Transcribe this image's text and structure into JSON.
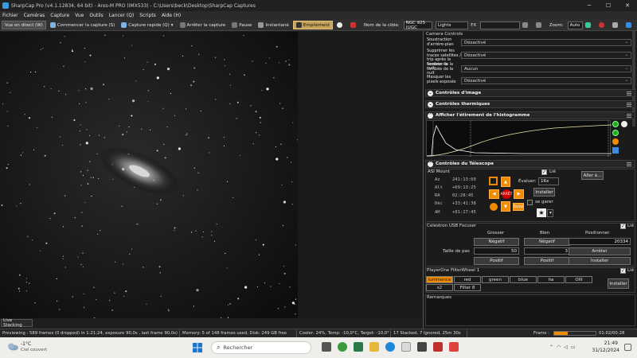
{
  "window": {
    "title": "SharpCap Pro (v4.1.12834, 64 bit) - Ares-M PRO (IMX533) - C:\\Users\\beck\\Desktop\\SharpCap Captures",
    "minimize": "─",
    "maximize": "☐",
    "close": "✕"
  },
  "menu": [
    "Fichier",
    "Caméras",
    "Capture",
    "Vue",
    "Outils",
    "Lancer (Q)",
    "Scripts",
    "Aide (H)"
  ],
  "toolbar": {
    "live_view": "Vue en direct (W)",
    "start_capture": "Commencer la capture (S)",
    "quick_capture": "Capture rapide (Q)",
    "stop_capture": "Arrêter la capture",
    "pause": "Pause",
    "snapshot": "Instantané",
    "stacking": "Empilement",
    "target_label": "Nom de la cible:",
    "target_value": "NGC 925 (UGC",
    "frame_type": "Lights",
    "fx": "FX",
    "zoom_label": "Zoom:",
    "zoom_value": "Auto"
  },
  "panel": {
    "camera_controls_title": "Camera Controls",
    "rows": [
      {
        "label": "Soustraction d'arrière-plan",
        "value": "Désactivé"
      },
      {
        "label": "Supprimer les traces satellites / trip après la tombée de la nuit",
        "value": "Désactivé"
      },
      {
        "label": "Scanner la tombée de la nuit",
        "value": "Aucun"
      },
      {
        "label": "Masquer les pixels exposés",
        "value": "Désactivé"
      }
    ],
    "image_controls": "Contrôles d'image",
    "thermal_controls": "Contrôles thermiques",
    "histogram": "Afficher l'étirement de l'histogramme",
    "telescope": "Contrôles du Télescope",
    "mount": {
      "name": "ASI Mount",
      "linked": "Lié",
      "goto": "Aller à...",
      "eval_label": "Évaluer:",
      "eval_value": "16x",
      "install": "Installer",
      "guide": "se garer",
      "stop": "ARRÊT",
      "follow": "Suivi",
      "az_label": "Az",
      "az": "241:13:00",
      "alt_label": "Alt",
      "alt": "+69:13:25",
      "ra_label": "RA",
      "ra": "02:28:45",
      "dec_label": "Déc",
      "dec": "+33:41:38",
      "ah_label": "AH",
      "ah": "+01:27:45"
    },
    "focuser": {
      "name": "Celestron USB Focuser",
      "linked": "Lié",
      "col_coarse": "Grosser",
      "col_fine": "Bien",
      "col_position": "Positionner",
      "negative": "Négatif",
      "positive": "Positif",
      "position_value": "20334",
      "step_label": "Taille de pas",
      "step_coarse": "50",
      "step_fine": "3",
      "stop": "Arrêter",
      "install": "Installer"
    },
    "filterwheel": {
      "name": "PlayerOne FilterWheel 1",
      "linked": "Lié",
      "filters": [
        "luminance",
        "red",
        "green",
        "blue",
        "ha",
        "OIII",
        "s2",
        "Filter 8"
      ],
      "install": "Installer"
    },
    "remarks": "Remarques"
  },
  "live_stacking_tab": "Live Stacking",
  "status": {
    "previewing": "Previewing : 589 frames (0 dropped) in 1:21:24, exposure 90,0s , last frame 90,0s)",
    "memory": "Memory: 5 of 148 frames used, Disk: 249 GB free",
    "cooler": "Cooler: 24%, Temp: -10,0°C, Target: -10,0°",
    "stacked": "17 Stacked, 7 Ignored, 25m 30s",
    "frame_label": "Frame :",
    "frame_counter": "01:02/00:28",
    "frame_progress": 0.32
  },
  "taskbar": {
    "weather_temp": "-1°C",
    "weather_desc": "Ciel couvert",
    "search": "Rechercher",
    "time": "21:49",
    "date": "31/12/2024"
  },
  "colors": {
    "accent": "#f08a00",
    "panel_bg": "#1b1b1b",
    "histogram_curve": "#f0e6b0"
  }
}
